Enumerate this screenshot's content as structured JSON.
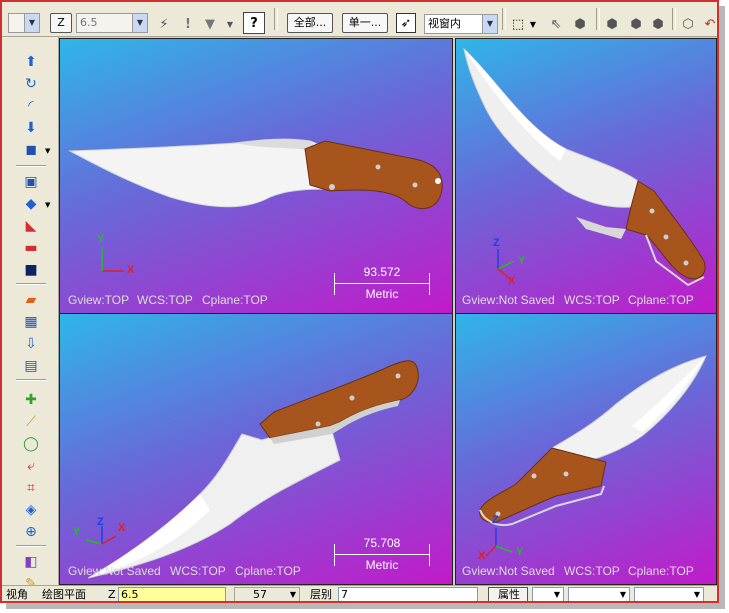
{
  "toolbar": {
    "z_label": "Z",
    "z_value": "6.5",
    "all_button": "全部...",
    "single_button": "单一...",
    "view_select": "视窗内"
  },
  "viewports": [
    {
      "gview": "Gview:TOP",
      "wcs": "WCS:TOP",
      "cplane": "Cplane:TOP",
      "scale_value": "93.572",
      "scale_unit": "Metric",
      "axes": [
        "Y",
        "X"
      ]
    },
    {
      "gview": "Gview:Not Saved",
      "wcs": "WCS:TOP",
      "cplane": "Cplane:TOP",
      "axes": [
        "Z",
        "Y",
        "X"
      ]
    },
    {
      "gview": "Gview:Not Saved",
      "wcs": "WCS:TOP",
      "cplane": "Cplane:TOP",
      "scale_value": "75.708",
      "scale_unit": "Metric",
      "axes": [
        "Y",
        "Z",
        "X"
      ]
    },
    {
      "gview": "Gview:Not Saved",
      "wcs": "WCS:TOP",
      "cplane": "Cplane:TOP",
      "axes": [
        "Z",
        "X",
        "Y"
      ]
    }
  ],
  "statusbar": {
    "view_label": "视角",
    "plane_label": "绘图平面",
    "z_label": "Z",
    "z_value": "6.5",
    "color_value": "57",
    "level_label": "层别",
    "level_value": "7",
    "attr_label": "属性"
  },
  "colors": {
    "blade": "#f2f2f2",
    "handle": "#a8541d",
    "frame_border": "#d23030"
  },
  "icons": [
    "undo-icon",
    "help-icon",
    "select-window-icon",
    "arrow-cursor-icon",
    "cube-icon",
    "sphere-icon",
    "shade-icon"
  ]
}
